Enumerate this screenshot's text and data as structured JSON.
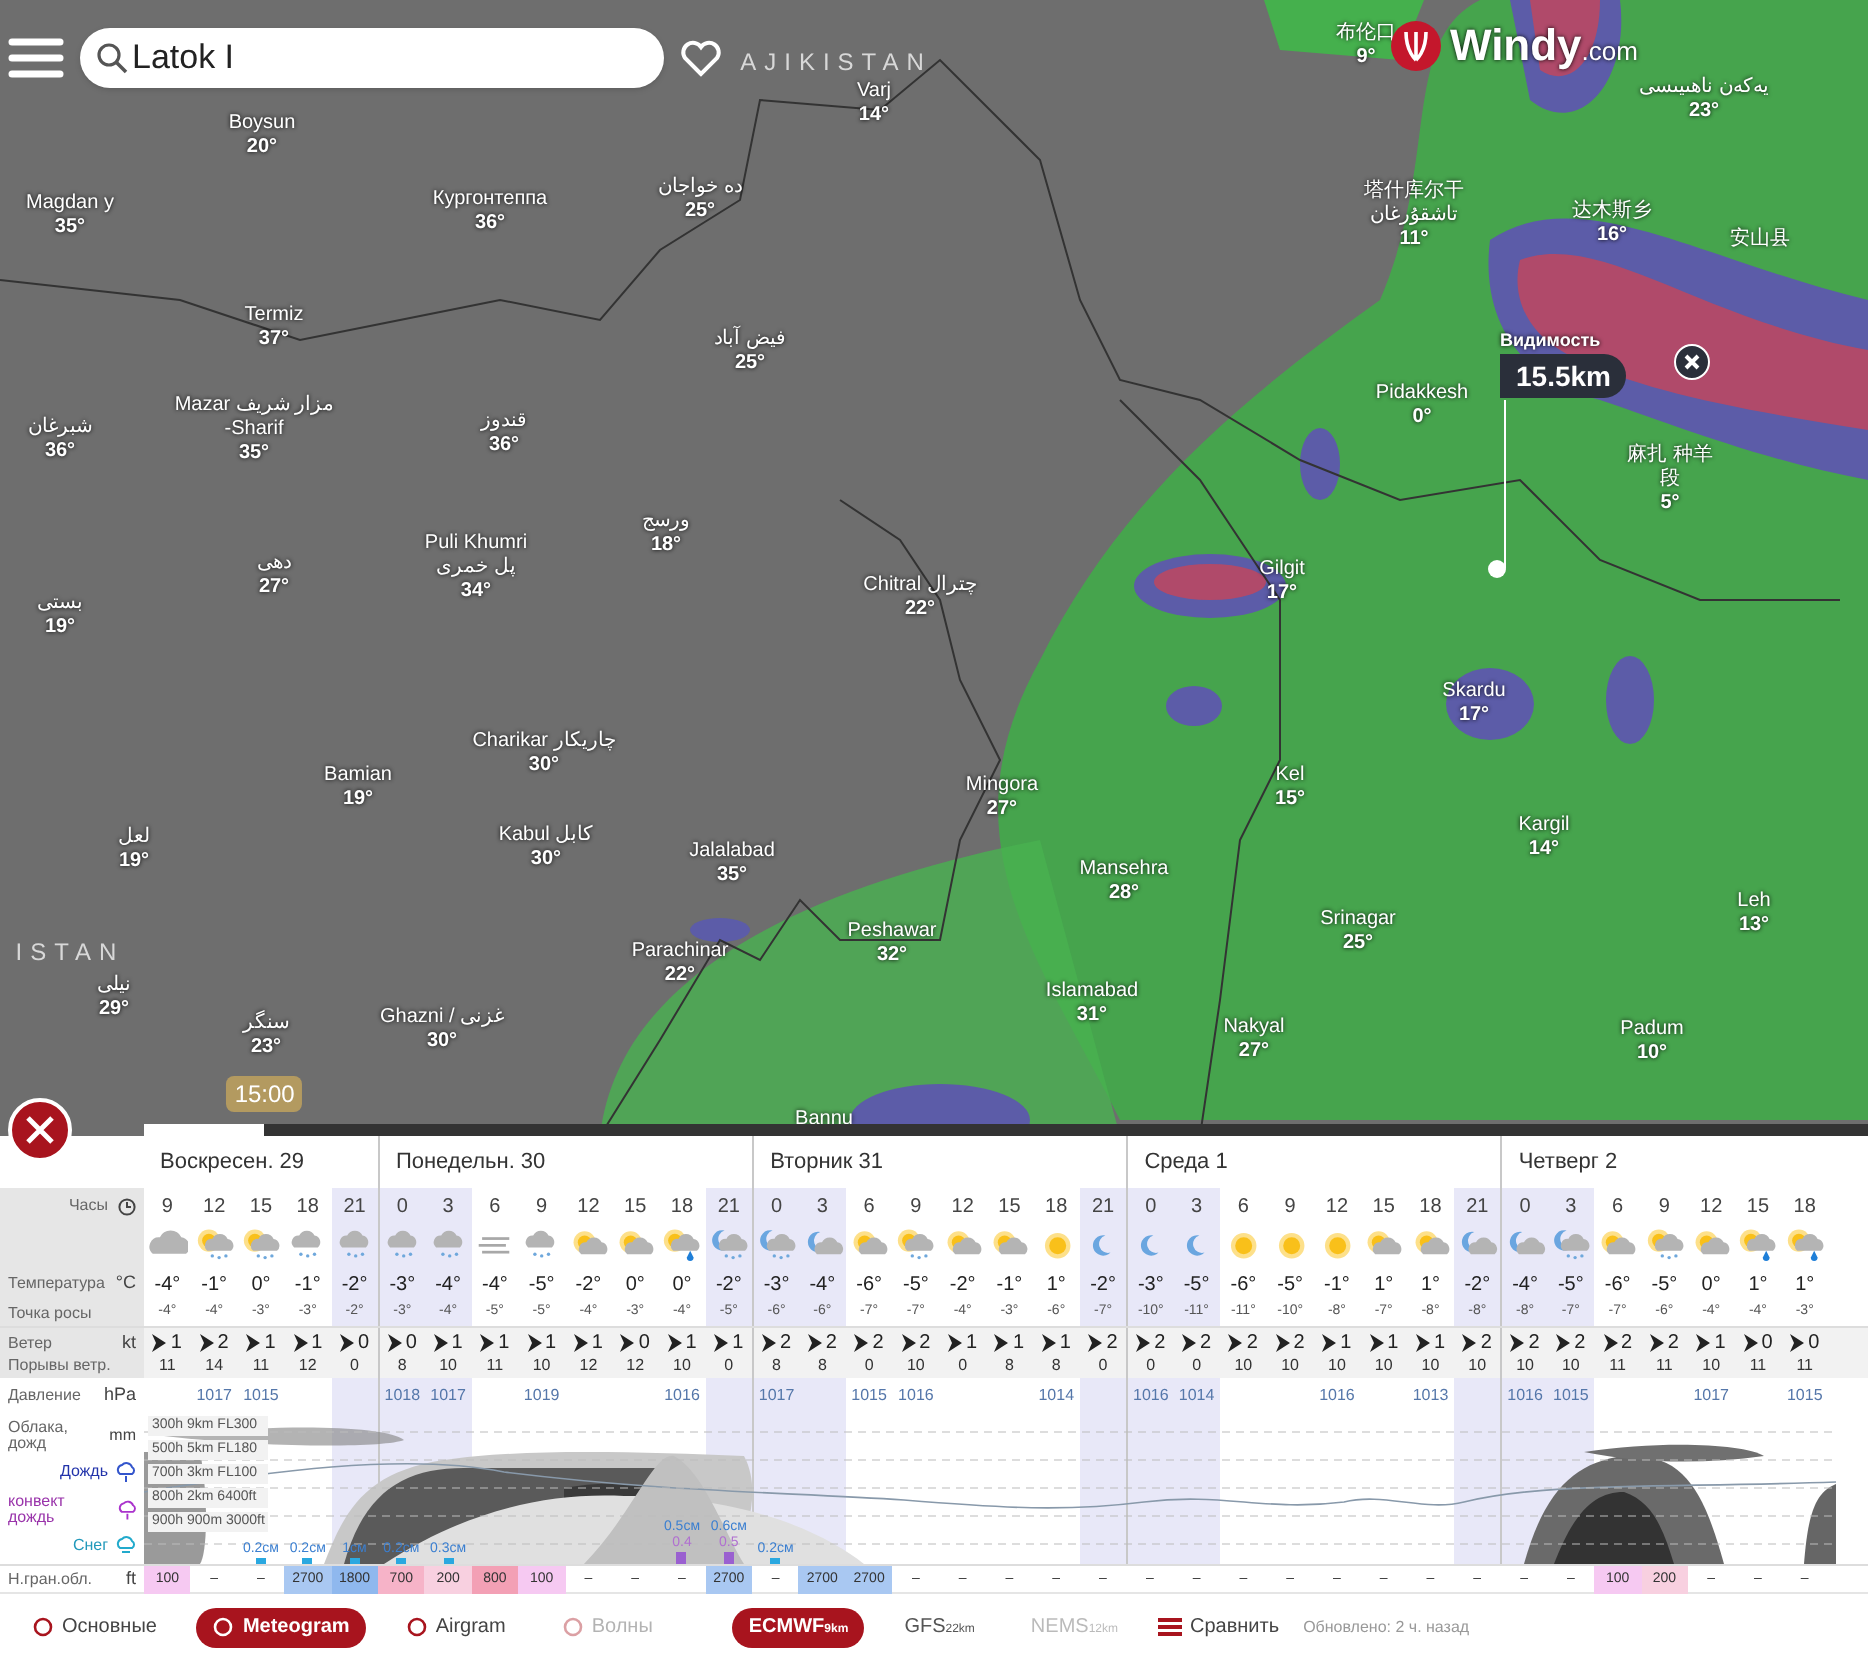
{
  "top_bar": {
    "search": {
      "value": "Latok I"
    },
    "logo": {
      "name": "Windy",
      "suffix": ".com"
    }
  },
  "map": {
    "country_labels": [
      "AJIKISTAN",
      "ISTAN"
    ],
    "places": [
      {
        "lines": [
          "Boysun"
        ],
        "temp": "20°"
      },
      {
        "lines": [
          "Magdan y"
        ],
        "temp": "35°"
      },
      {
        "lines": [
          "Кургонтеппа"
        ],
        "temp": "36°"
      },
      {
        "lines": [
          "ده خواجان"
        ],
        "temp": "25°"
      },
      {
        "lines": [
          "Varj"
        ],
        "temp": "14°"
      },
      {
        "lines": [
          "Termiz"
        ],
        "temp": "37°"
      },
      {
        "lines": [
          "فیض آباد"
        ],
        "temp": "25°"
      },
      {
        "lines": [
          "شبرغان"
        ],
        "temp": "36°"
      },
      {
        "lines": [
          "Mazar مزار شريف",
          "-Sharif"
        ],
        "temp": "35°"
      },
      {
        "lines": [
          "قندوز"
        ],
        "temp": "36°"
      },
      {
        "lines": [
          "ورسج"
        ],
        "temp": "18°"
      },
      {
        "lines": [
          "دهی"
        ],
        "temp": "27°"
      },
      {
        "lines": [
          "Puli Khumri",
          "پل خمری"
        ],
        "temp": "34°"
      },
      {
        "lines": [
          "بستی"
        ],
        "temp": "19°"
      },
      {
        "lines": [
          "Chitral چترال"
        ],
        "temp": "22°"
      },
      {
        "lines": [
          "Gilgit"
        ],
        "temp": "17°"
      },
      {
        "lines": [
          "Pidakkesh"
        ],
        "temp": "0°"
      },
      {
        "lines": [
          "布伦口"
        ],
        "temp": "9°"
      },
      {
        "lines": [
          "塔什库尔干",
          "تاشقۇرغان"
        ],
        "temp": "11°"
      },
      {
        "lines": [
          "يەكەن ناھىيىسى"
        ],
        "temp": "23°"
      },
      {
        "lines": [
          "达木斯乡"
        ],
        "temp": "16°"
      },
      {
        "lines": [
          "安山县"
        ]
      },
      {
        "lines": [
          "麻扎 种羊",
          "段"
        ],
        "temp": "5°"
      },
      {
        "lines": [
          "Skardu"
        ],
        "temp": "17°"
      },
      {
        "lines": [
          "Kel"
        ],
        "temp": "15°"
      },
      {
        "lines": [
          "Kargil"
        ],
        "temp": "14°"
      },
      {
        "lines": [
          "Leh"
        ],
        "temp": "13°"
      },
      {
        "lines": [
          "Srinagar"
        ],
        "temp": "25°"
      },
      {
        "lines": [
          "Nakyal"
        ],
        "temp": "27°"
      },
      {
        "lines": [
          "Padum"
        ],
        "temp": "10°"
      },
      {
        "lines": [
          "Mingora"
        ],
        "temp": "27°"
      },
      {
        "lines": [
          "Mansehra"
        ],
        "temp": "28°"
      },
      {
        "lines": [
          "Islamabad"
        ],
        "temp": "31°"
      },
      {
        "lines": [
          "Peshawar"
        ],
        "temp": "32°"
      },
      {
        "lines": [
          "Jalalabad"
        ],
        "temp": "35°"
      },
      {
        "lines": [
          "Parachinar"
        ],
        "temp": "22°"
      },
      {
        "lines": [
          "Charikar چاریکار"
        ],
        "temp": "30°"
      },
      {
        "lines": [
          "Bamian"
        ],
        "temp": "19°"
      },
      {
        "lines": [
          "Kabul کابل"
        ],
        "temp": "30°"
      },
      {
        "lines": [
          "سنگر"
        ],
        "temp": "23°"
      },
      {
        "lines": [
          "Ghazni / غزنی"
        ],
        "temp": "30°"
      },
      {
        "lines": [
          "نیلی"
        ],
        "temp": "29°"
      },
      {
        "lines": [
          "لعل"
        ],
        "temp": "19°"
      },
      {
        "lines": [
          "Bannu"
        ]
      }
    ],
    "popup": {
      "label": "Видимость",
      "value": "15.5km"
    },
    "timeline": {
      "time": "15:00",
      "level": 0.07
    }
  },
  "meteogram": {
    "row_labels": {
      "hours": {
        "label": "Часы"
      },
      "temperature": {
        "label": "Температура",
        "unit": "°C"
      },
      "dew_point": {
        "label": "Точка росы"
      },
      "wind": {
        "label": "Ветер",
        "unit": "kt"
      },
      "gusts": {
        "label": "Порывы ветр."
      },
      "pressure": {
        "label": "Давление",
        "unit": "hPa"
      },
      "clouds": {
        "label": "Облака, дожд",
        "unit": "mm"
      },
      "rain": {
        "label": "Дождь"
      },
      "convective_rain": {
        "label": "конвект дождь"
      },
      "snow": {
        "label": "Снег"
      },
      "cloud_base": {
        "label": "Н.гран.обл.",
        "unit": "ft"
      }
    },
    "cloud_levels": [
      "300h 9km FL300",
      "500h 5km FL180",
      "700h 3km FL100",
      "800h 2km 6400ft",
      "900h 900m 3000ft"
    ],
    "columns": [
      {
        "day": "Воскресен. 29",
        "hour": "9",
        "kind": "cloud",
        "temp": "-4°",
        "dew": "-4°",
        "wind": "1",
        "gust": "11",
        "night": false,
        "base": "100",
        "color": "#f6c9f2"
      },
      {
        "hour": "12",
        "kind": "sun-cloud-snow",
        "temp": "-1°",
        "dew": "-4°",
        "wind": "2",
        "gust": "14",
        "night": false,
        "pressure": "1017",
        "base": "–"
      },
      {
        "hour": "15",
        "kind": "sun-cloud-snow",
        "temp": "0°",
        "dew": "-3°",
        "wind": "1",
        "gust": "11",
        "night": false,
        "pressure": "1015",
        "precip": "0.2см",
        "base": "–"
      },
      {
        "hour": "18",
        "kind": "cloud-snow",
        "temp": "-1°",
        "dew": "-3°",
        "wind": "1",
        "gust": "12",
        "night": false,
        "precip": "0.2см",
        "base": "2700",
        "color": "#a9c8f2"
      },
      {
        "hour": "21",
        "kind": "cloud-snow",
        "temp": "-2°",
        "dew": "-2°",
        "wind": "0",
        "gust": "0",
        "night": true,
        "precip": "1см",
        "base": "1800",
        "color": "#8fb8ee"
      },
      {
        "day": "Понедельн. 30",
        "hour": "0",
        "kind": "cloud-snow",
        "temp": "-3°",
        "dew": "-3°",
        "wind": "0",
        "gust": "8",
        "night": true,
        "pressure": "1018",
        "precip": "0.2см",
        "base": "700",
        "color": "#f6b3c8"
      },
      {
        "hour": "3",
        "kind": "cloud-snow",
        "temp": "-4°",
        "dew": "-4°",
        "wind": "1",
        "gust": "10",
        "night": true,
        "pressure": "1017",
        "precip": "0.3см",
        "base": "200",
        "color": "#f8d0e0"
      },
      {
        "hour": "6",
        "kind": "fog",
        "temp": "-4°",
        "dew": "-5°",
        "wind": "1",
        "gust": "11",
        "night": false,
        "base": "800",
        "color": "#f3a0b5"
      },
      {
        "hour": "9",
        "kind": "cloud-snow",
        "temp": "-5°",
        "dew": "-5°",
        "wind": "1",
        "gust": "10",
        "night": false,
        "pressure": "1019",
        "base": "100",
        "color": "#f6c9f2"
      },
      {
        "hour": "12",
        "kind": "sun-cloud",
        "temp": "-2°",
        "dew": "-4°",
        "wind": "1",
        "gust": "12",
        "night": false,
        "base": "–"
      },
      {
        "hour": "15",
        "kind": "sun-cloud",
        "temp": "0°",
        "dew": "-3°",
        "wind": "0",
        "gust": "12",
        "night": false,
        "base": "–"
      },
      {
        "hour": "18",
        "kind": "sun-cloud-rain",
        "temp": "0°",
        "dew": "-4°",
        "wind": "1",
        "gust": "10",
        "night": false,
        "pressure": "1016",
        "precip": "0.5см",
        "conv": "0.4",
        "base": "–"
      },
      {
        "hour": "21",
        "kind": "moon-cloud-snow",
        "temp": "-2°",
        "dew": "-5°",
        "wind": "1",
        "gust": "0",
        "night": true,
        "precip": "0.6см",
        "conv": "0.5",
        "base": "2700",
        "color": "#a9c8f2"
      },
      {
        "day": "Вторник 31",
        "hour": "0",
        "kind": "moon-cloud-snow",
        "temp": "-3°",
        "dew": "-6°",
        "wind": "2",
        "gust": "8",
        "night": true,
        "pressure": "1017",
        "precip": "0.2см",
        "base": "–"
      },
      {
        "hour": "3",
        "kind": "moon-cloud",
        "temp": "-4°",
        "dew": "-6°",
        "wind": "2",
        "gust": "8",
        "night": true,
        "base": "2700",
        "color": "#a9c8f2"
      },
      {
        "hour": "6",
        "kind": "sun-cloud",
        "temp": "-6°",
        "dew": "-7°",
        "wind": "2",
        "gust": "0",
        "night": false,
        "pressure": "1015",
        "base": "2700",
        "color": "#a9c8f2"
      },
      {
        "hour": "9",
        "kind": "sun-cloud-snow",
        "temp": "-5°",
        "dew": "-7°",
        "wind": "2",
        "gust": "10",
        "night": false,
        "pressure": "1016",
        "base": "–"
      },
      {
        "hour": "12",
        "kind": "sun-cloud",
        "temp": "-2°",
        "dew": "-4°",
        "wind": "1",
        "gust": "0",
        "night": false,
        "base": "–"
      },
      {
        "hour": "15",
        "kind": "sun-cloud",
        "temp": "-1°",
        "dew": "-3°",
        "wind": "1",
        "gust": "8",
        "night": false,
        "base": "–"
      },
      {
        "hour": "18",
        "kind": "sun",
        "temp": "1°",
        "dew": "-6°",
        "wind": "1",
        "gust": "8",
        "night": false,
        "pressure": "1014",
        "base": "–"
      },
      {
        "hour": "21",
        "kind": "moon",
        "temp": "-2°",
        "dew": "-7°",
        "wind": "2",
        "gust": "0",
        "night": true,
        "base": "–"
      },
      {
        "day": "Среда 1",
        "hour": "0",
        "kind": "moon",
        "temp": "-3°",
        "dew": "-10°",
        "wind": "2",
        "gust": "0",
        "night": true,
        "pressure": "1016",
        "base": "–"
      },
      {
        "hour": "3",
        "kind": "moon",
        "temp": "-5°",
        "dew": "-11°",
        "wind": "2",
        "gust": "0",
        "night": true,
        "pressure": "1014",
        "base": "–"
      },
      {
        "hour": "6",
        "kind": "sun",
        "temp": "-6°",
        "dew": "-11°",
        "wind": "2",
        "gust": "10",
        "night": false,
        "base": "–"
      },
      {
        "hour": "9",
        "kind": "sun",
        "temp": "-5°",
        "dew": "-10°",
        "wind": "2",
        "gust": "10",
        "night": false,
        "base": "–"
      },
      {
        "hour": "12",
        "kind": "sun",
        "temp": "-1°",
        "dew": "-8°",
        "wind": "1",
        "gust": "10",
        "night": false,
        "pressure": "1016",
        "base": "–"
      },
      {
        "hour": "15",
        "kind": "sun-cloud",
        "temp": "1°",
        "dew": "-7°",
        "wind": "1",
        "gust": "10",
        "night": false,
        "base": "–"
      },
      {
        "hour": "18",
        "kind": "sun-cloud",
        "temp": "1°",
        "dew": "-8°",
        "wind": "1",
        "gust": "10",
        "night": false,
        "pressure": "1013",
        "base": "–"
      },
      {
        "hour": "21",
        "kind": "moon-cloud",
        "temp": "-2°",
        "dew": "-8°",
        "wind": "2",
        "gust": "10",
        "night": true,
        "base": "–"
      },
      {
        "day": "Четверг 2",
        "hour": "0",
        "kind": "moon-cloud",
        "temp": "-4°",
        "dew": "-8°",
        "wind": "2",
        "gust": "10",
        "night": true,
        "pressure": "1016",
        "base": "–"
      },
      {
        "hour": "3",
        "kind": "moon-cloud-snow",
        "temp": "-5°",
        "dew": "-7°",
        "wind": "2",
        "gust": "10",
        "night": true,
        "pressure": "1015",
        "base": "–"
      },
      {
        "hour": "6",
        "kind": "sun-cloud",
        "temp": "-6°",
        "dew": "-7°",
        "wind": "2",
        "gust": "11",
        "night": false,
        "base": "100",
        "color": "#f6c9f2"
      },
      {
        "hour": "9",
        "kind": "sun-cloud-snow",
        "temp": "-5°",
        "dew": "-6°",
        "wind": "2",
        "gust": "11",
        "night": false,
        "base": "200",
        "color": "#f8d0e0"
      },
      {
        "hour": "12",
        "kind": "sun-cloud",
        "temp": "0°",
        "dew": "-4°",
        "wind": "1",
        "gust": "10",
        "night": false,
        "pressure": "1017",
        "base": "–"
      },
      {
        "hour": "15",
        "kind": "sun-cloud-rain",
        "temp": "1°",
        "dew": "-4°",
        "wind": "0",
        "gust": "11",
        "night": false,
        "base": "–"
      },
      {
        "hour": "18",
        "kind": "sun-cloud-rain",
        "temp": "1°",
        "dew": "-3°",
        "wind": "0",
        "gust": "11",
        "night": false,
        "pressure": "1015",
        "base": "–"
      }
    ]
  },
  "bottom_bar": {
    "view_tabs": [
      {
        "label": "Основные",
        "selected": false,
        "disabled": false
      },
      {
        "label": "Meteogram",
        "selected": true,
        "disabled": false
      },
      {
        "label": "Airgram",
        "selected": false,
        "disabled": false
      },
      {
        "label": "Волны",
        "selected": false,
        "disabled": true
      }
    ],
    "models": [
      {
        "name": "ECMWF",
        "resolution": "9km",
        "selected": true,
        "disabled": false
      },
      {
        "name": "GFS",
        "resolution": "22km",
        "selected": false,
        "disabled": false
      },
      {
        "name": "NEMS",
        "resolution": "12km",
        "selected": false,
        "disabled": true
      }
    ],
    "compare": {
      "label": "Сравнить"
    },
    "updated": "Обновлено: 2 ч. назад"
  }
}
